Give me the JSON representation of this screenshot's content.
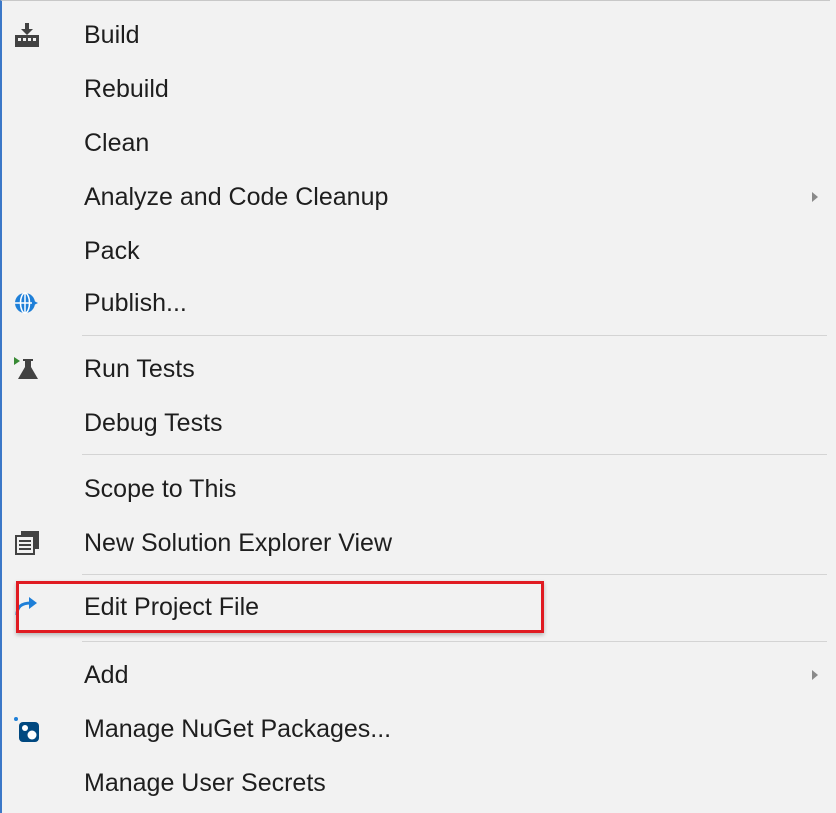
{
  "menu": {
    "items": [
      {
        "label": "Build",
        "icon": "build-icon"
      },
      {
        "label": "Rebuild"
      },
      {
        "label": "Clean"
      },
      {
        "label": "Analyze and Code Cleanup",
        "submenu": true
      },
      {
        "label": "Pack"
      },
      {
        "label": "Publish...",
        "icon": "publish-globe-icon"
      },
      {
        "label": "Run Tests",
        "icon": "run-tests-icon"
      },
      {
        "label": "Debug Tests"
      },
      {
        "label": "Scope to This"
      },
      {
        "label": "New Solution Explorer View",
        "icon": "new-view-icon"
      },
      {
        "label": "Edit Project File",
        "icon": "edit-project-file-icon",
        "highlighted": true
      },
      {
        "label": "Add",
        "submenu": true
      },
      {
        "label": "Manage NuGet Packages...",
        "icon": "nuget-icon"
      },
      {
        "label": "Manage User Secrets"
      }
    ]
  },
  "colors": {
    "background": "#f2f2f2",
    "highlight_border": "#e01b22",
    "separator": "#d4d4d4",
    "globe": "#1e7fd8"
  }
}
